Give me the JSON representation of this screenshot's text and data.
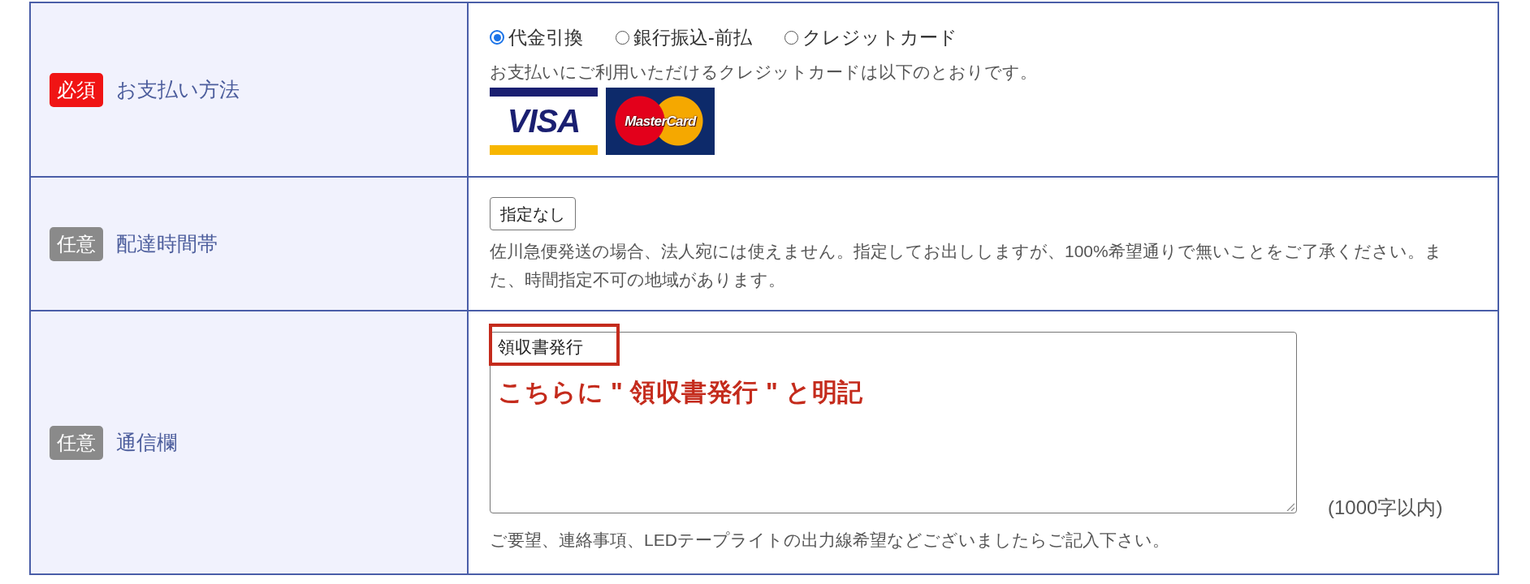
{
  "form_rows": [
    {
      "kind": "payment",
      "badge": {
        "text": "必須",
        "color": "#f01414"
      },
      "label": "お支払い方法",
      "options": [
        {
          "label": "代金引換",
          "selected": true
        },
        {
          "label": "銀行振込-前払",
          "selected": false
        },
        {
          "label": "クレジットカード",
          "selected": false
        }
      ],
      "note": "お支払いにご利用いただけるクレジットカードは以下のとおりです。",
      "card_logos": [
        {
          "kind": "visa",
          "text": "VISA"
        },
        {
          "kind": "mastercard",
          "text": "MasterCard"
        }
      ]
    },
    {
      "kind": "select",
      "badge": {
        "text": "任意",
        "color": "#8a8a8a"
      },
      "label": "配達時間帯",
      "select": {
        "value": "指定なし"
      },
      "note": "佐川急便発送の場合、法人宛には使えません。指定してお出ししますが、100%希望通りで無いことをご了承ください。また、時間指定不可の地域があります。"
    },
    {
      "kind": "textarea",
      "badge": {
        "text": "任意",
        "color": "#8a8a8a"
      },
      "label": "通信欄",
      "textarea": {
        "value": "領収書発行",
        "highlight": true
      },
      "annotation": "こちらに \" 領収書発行 \" と明記",
      "limit": "(1000字以内)",
      "note": "ご要望、連絡事項、LEDテープライトの出力線希望などございましたらご記入下さい。"
    }
  ]
}
